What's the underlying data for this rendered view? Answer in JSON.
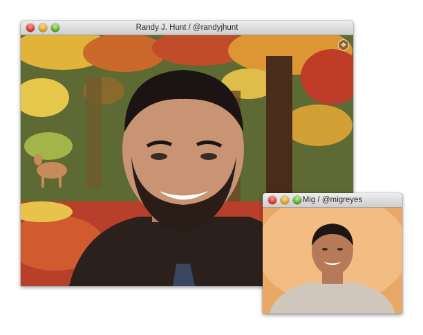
{
  "main_window": {
    "title": "Randy J. Hunt  /  @randyjhunt",
    "controls": [
      "close",
      "minimize",
      "zoom"
    ],
    "fullscreen_icon": "fullscreen-arrows-icon"
  },
  "mini_window": {
    "title": "Mig  /  @migreyes",
    "controls": [
      "close",
      "minimize",
      "zoom"
    ]
  }
}
